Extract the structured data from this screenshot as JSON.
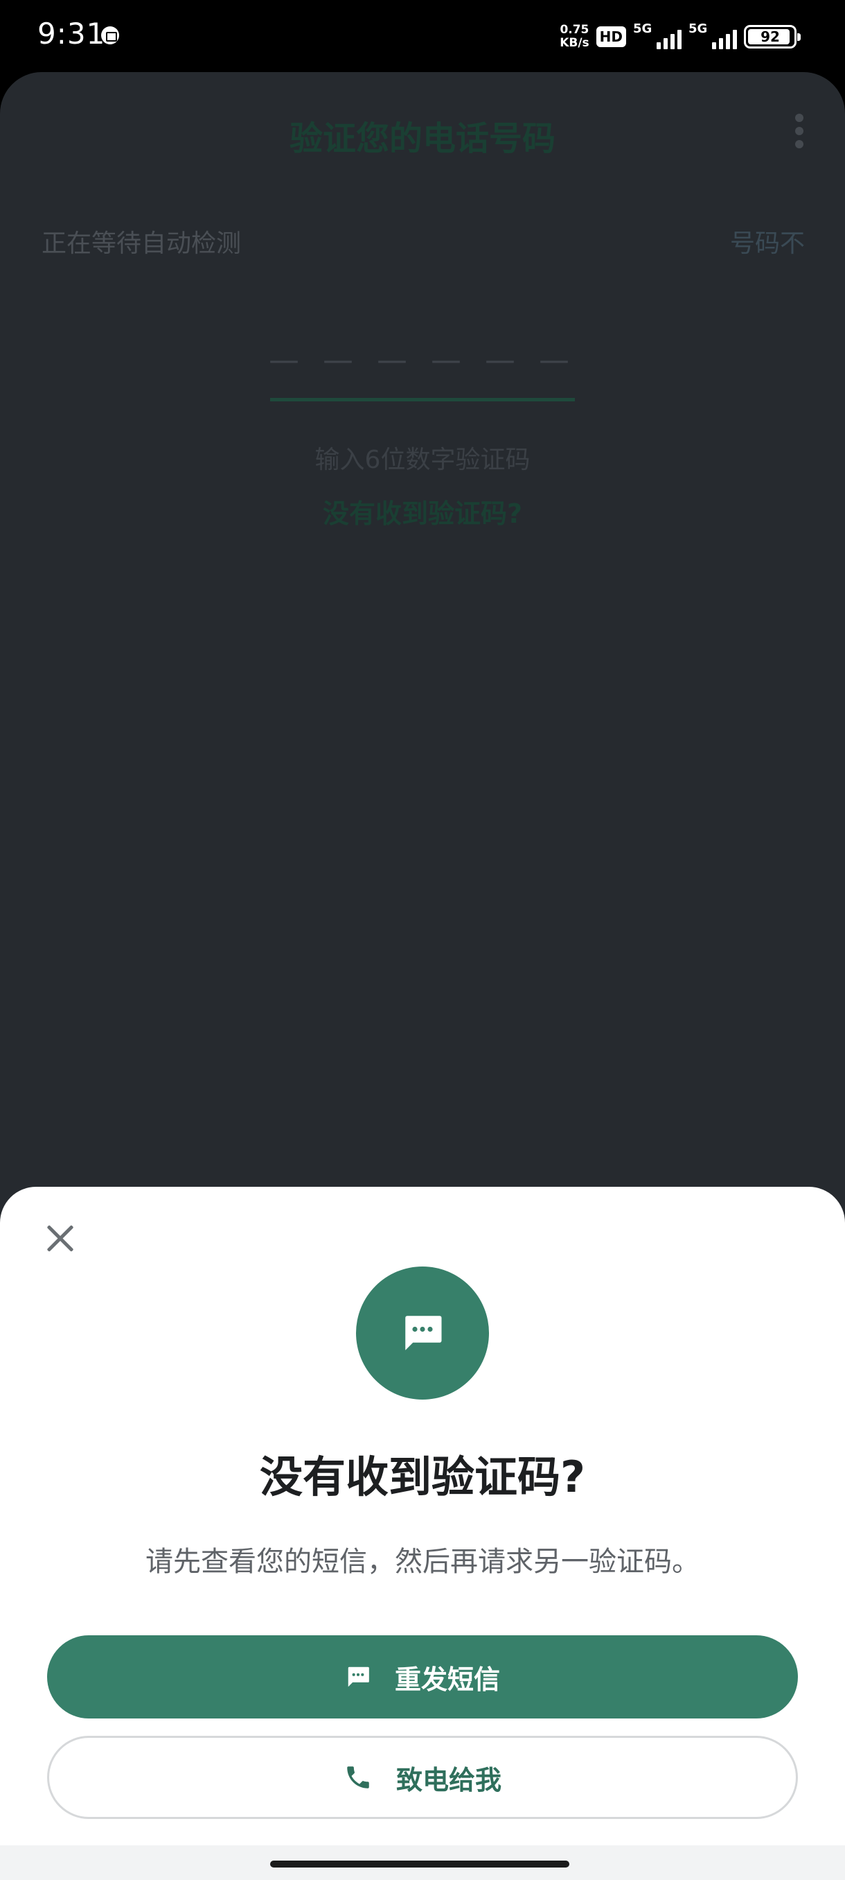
{
  "status_bar": {
    "time": "9:31",
    "net_speed_value": "0.75",
    "net_speed_unit": "KB/s",
    "hd_badge": "HD",
    "signal1_label": "5G",
    "signal2_label": "5G",
    "battery": "92"
  },
  "background_screen": {
    "title": "验证您的电话号码",
    "waiting_text": "正在等待自动检测",
    "waiting_right": "号码不",
    "code_placeholder": "— — —   — — —",
    "hint": "输入6位数字验证码",
    "not_received_link": "没有收到验证码?"
  },
  "sheet": {
    "title": "没有收到验证码?",
    "description": "请先查看您的短信，然后再请求另一验证码。",
    "resend_sms_label": "重发短信",
    "call_me_label": "致电给我"
  },
  "colors": {
    "accent": "#37806a",
    "overlay": "#262a2f"
  }
}
